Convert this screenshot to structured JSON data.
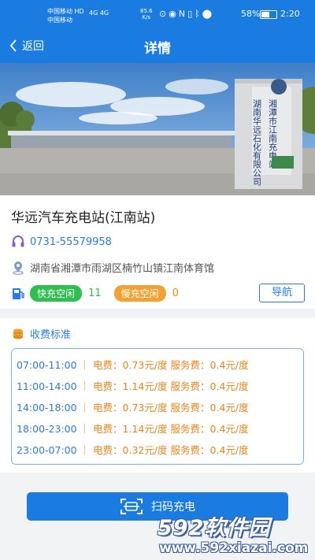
{
  "status_bar": {
    "carrier1": "中国移动 HD",
    "carrier2": "中国移动",
    "network": "4G 4G",
    "speed_value": "85.6",
    "speed_unit": "K/s",
    "battery_pct": "58%",
    "battery_level": 0.58,
    "time": "2:20"
  },
  "topbar": {
    "back_label": "返回",
    "title": "详情"
  },
  "station": {
    "name": "华远汽车充电站(江南站)",
    "phone": "0731-55579958",
    "address": "湖南省湘潭市雨湖区楠竹山镇江南体育馆",
    "fast_label": "快充空闲",
    "fast_count": "11",
    "slow_label": "慢充空闲",
    "slow_count": "0",
    "nav_label": "导航"
  },
  "photo": {
    "sign_text1": "湘潭市江南充电站",
    "sign_text2": "湖南华远石化有限公司"
  },
  "fees": {
    "header": "收费标准",
    "rows": [
      {
        "time": "07:00-11:00",
        "price": "电费：0.73元/度",
        "service": "服务费：0.4元/度"
      },
      {
        "time": "11:00-14:00",
        "price": "电费：1.14元/度",
        "service": "服务费：0.4元/度"
      },
      {
        "time": "14:00-18:00",
        "price": "电费：0.73元/度",
        "service": "服务费：0.4元/度"
      },
      {
        "time": "18:00-23:00",
        "price": "电费：1.14元/度",
        "service": "服务费：0.4元/度"
      },
      {
        "time": "23:00-07:00",
        "price": "电费：0.32元/度",
        "service": "服务费：0.4元/度"
      }
    ]
  },
  "scan_label": "扫码充电",
  "watermark": {
    "brand": "592软件园",
    "url": "www.592xiazai.com"
  },
  "colors": {
    "primary": "#1a7be0",
    "fast": "#2fbf4f",
    "slow": "#f3a132",
    "fee_text": "#e8851c"
  }
}
